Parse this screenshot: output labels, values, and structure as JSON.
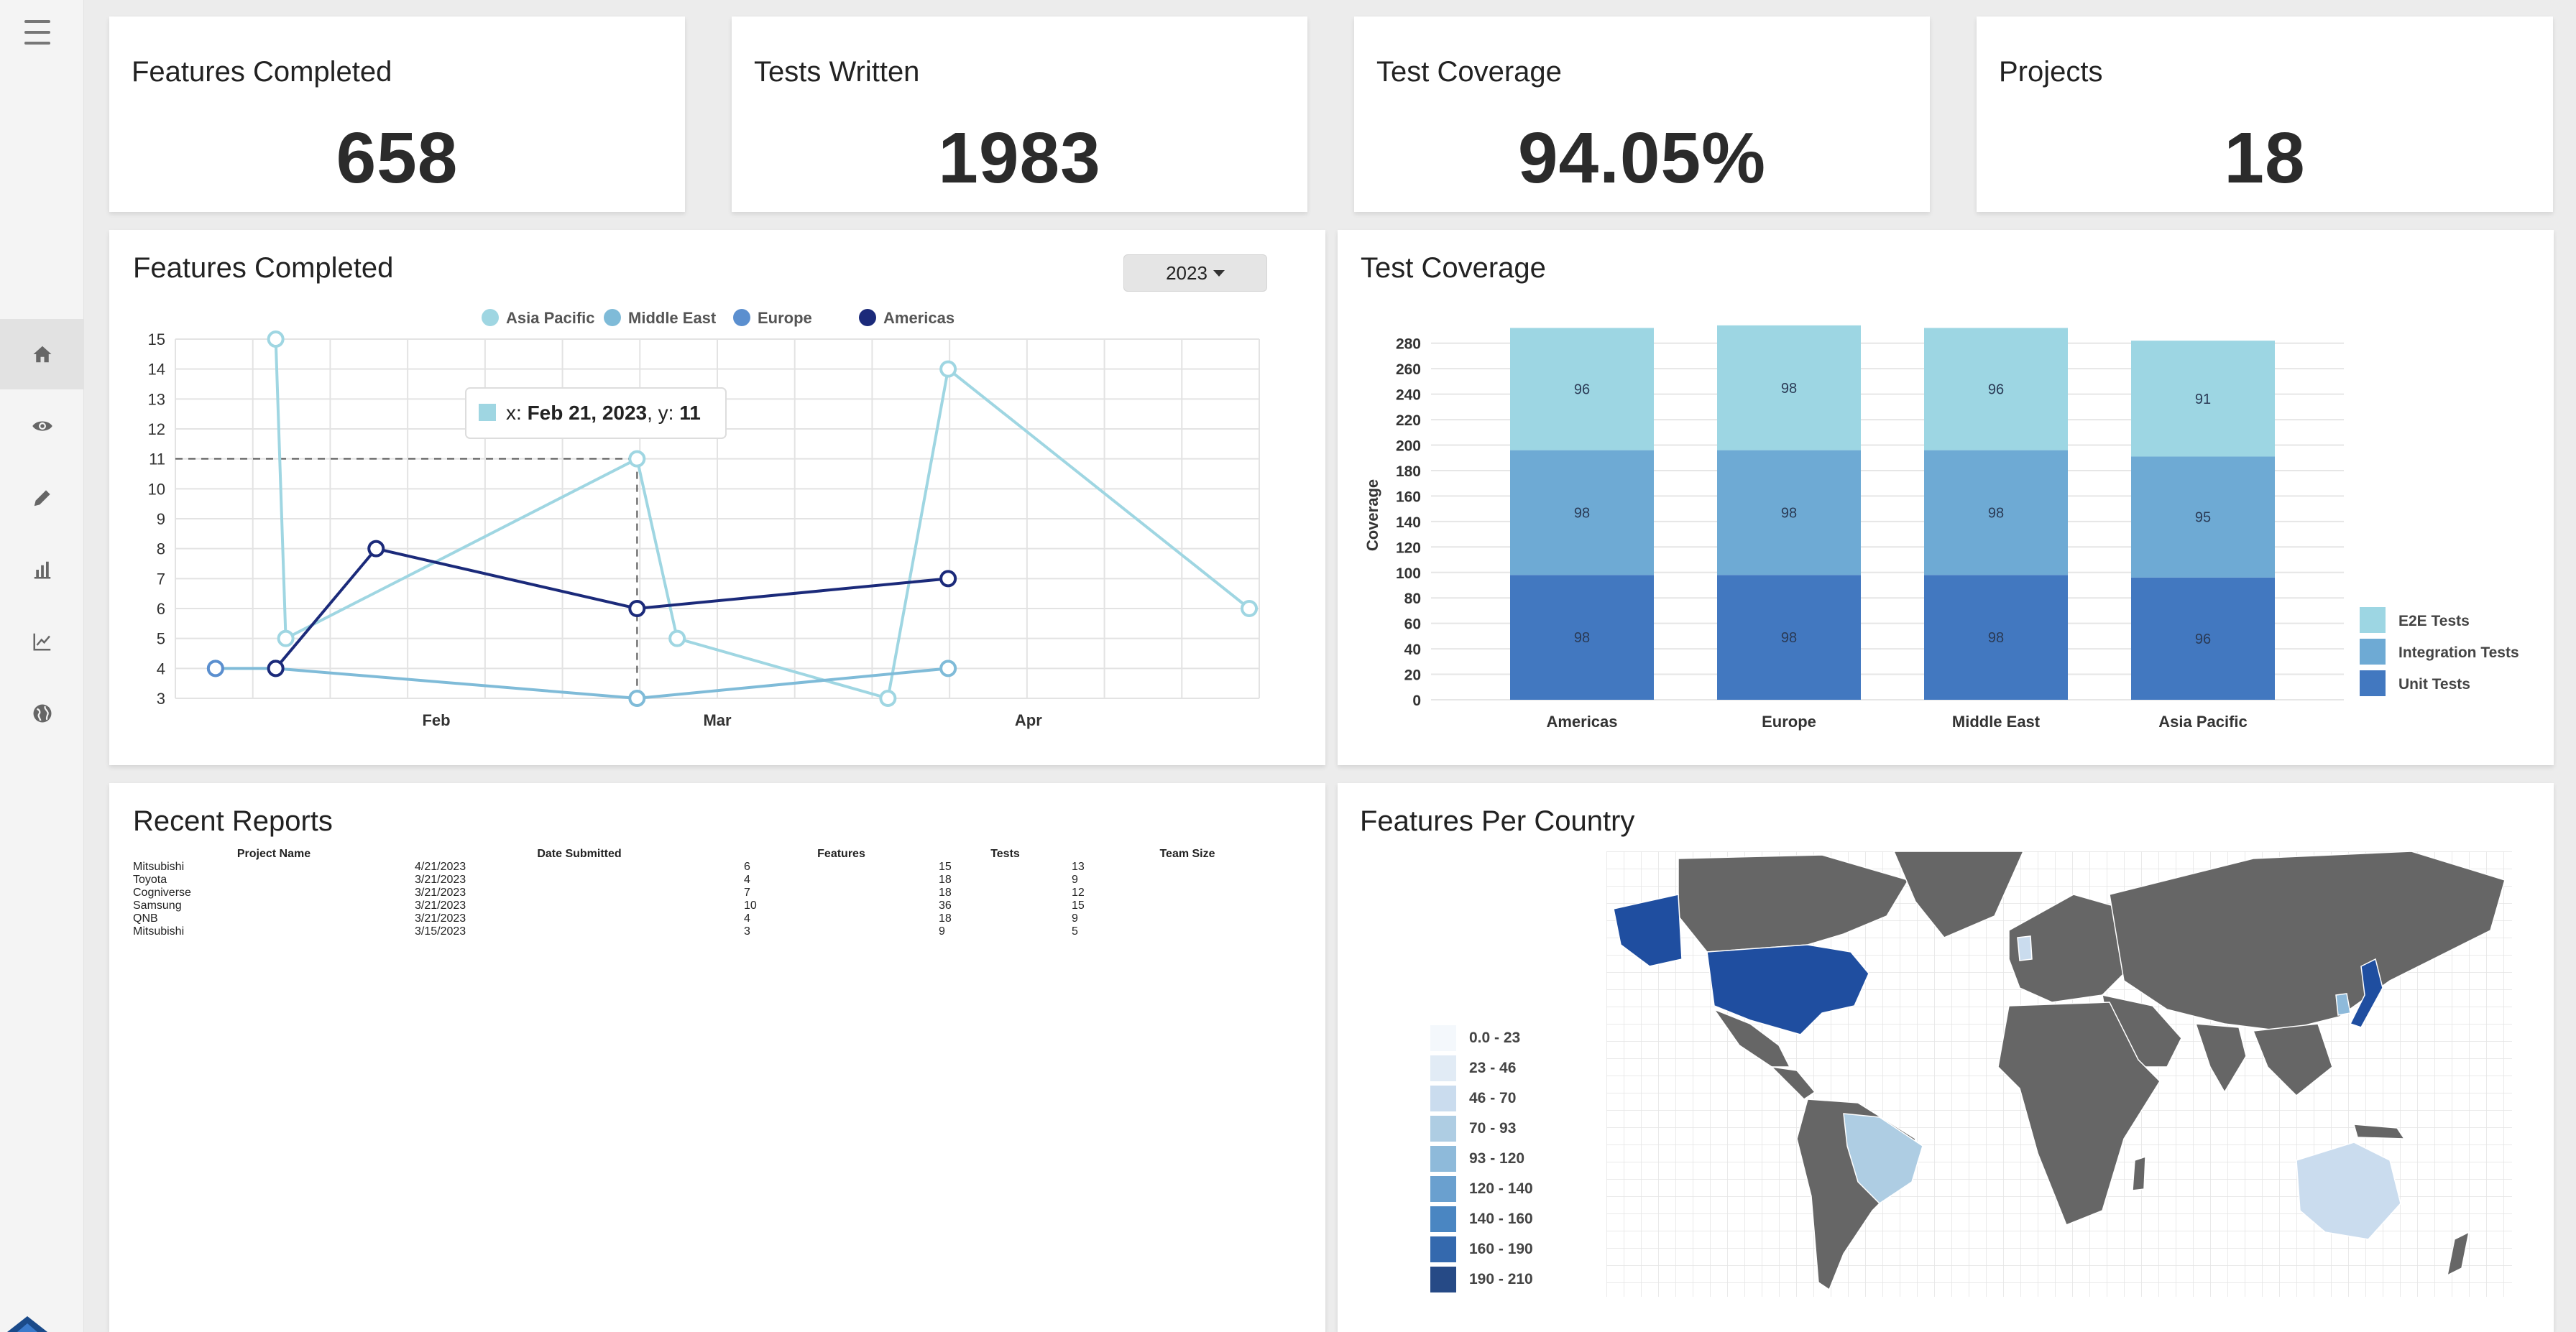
{
  "sidebar": {
    "menu_icon": "hamburger-icon",
    "items": [
      {
        "icon": "home-icon",
        "active": true
      },
      {
        "icon": "eye-icon",
        "active": false
      },
      {
        "icon": "pencil-icon",
        "active": false
      },
      {
        "icon": "bar-chart-icon",
        "active": false
      },
      {
        "icon": "line-chart-icon",
        "active": false
      },
      {
        "icon": "globe-icon",
        "active": false
      }
    ]
  },
  "stats": [
    {
      "title": "Features Completed",
      "value": "658"
    },
    {
      "title": "Tests Written",
      "value": "1983"
    },
    {
      "title": "Test Coverage",
      "value": "94.05%"
    },
    {
      "title": "Projects",
      "value": "18"
    }
  ],
  "features_panel": {
    "title": "Features Completed",
    "year_selector": "2023",
    "tooltip": {
      "x_label": "x: ",
      "x_value": "Feb 21, 2023",
      "y_label": ", y: ",
      "y_value": "11"
    }
  },
  "coverage_panel": {
    "title": "Test Coverage"
  },
  "reports": {
    "title": "Recent Reports",
    "columns": [
      "Project Name",
      "Date Submitted",
      "Features",
      "Tests",
      "Team Size"
    ],
    "rows": [
      [
        "Mitsubishi",
        "4/21/2023",
        "6",
        "15",
        "13"
      ],
      [
        "Toyota",
        "3/21/2023",
        "4",
        "18",
        "9"
      ],
      [
        "Cogniverse",
        "3/21/2023",
        "7",
        "18",
        "12"
      ],
      [
        "Samsung",
        "3/21/2023",
        "10",
        "36",
        "15"
      ],
      [
        "QNB",
        "3/21/2023",
        "4",
        "18",
        "9"
      ],
      [
        "Mitsubishi",
        "3/15/2023",
        "3",
        "9",
        "5"
      ]
    ]
  },
  "map_panel": {
    "title": "Features Per Country",
    "legend": [
      {
        "label": "0.0 - 23",
        "color": "#f4f8fc"
      },
      {
        "label": "23 - 46",
        "color": "#e1ebf5"
      },
      {
        "label": "46 - 70",
        "color": "#cadcee"
      },
      {
        "label": "70 - 93",
        "color": "#aecde3"
      },
      {
        "label": "93 - 120",
        "color": "#8ebada"
      },
      {
        "label": "120 - 140",
        "color": "#6aa0cf"
      },
      {
        "label": "140 - 160",
        "color": "#4a86c2"
      },
      {
        "label": "160 - 190",
        "color": "#3469ae"
      },
      {
        "label": "190 - 210",
        "color": "#264a86"
      }
    ]
  },
  "chart_data": [
    {
      "type": "line",
      "title": "Features Completed",
      "x_ticks": [
        "Feb",
        "Mar",
        "Apr"
      ],
      "ylim": [
        3,
        15
      ],
      "legend_position": "top",
      "series": [
        {
          "name": "Asia Pacific",
          "color": "#9fd6e2",
          "points": [
            [
              "2023-01-16",
              15
            ],
            [
              "2023-01-17",
              5
            ],
            [
              "2023-02-21",
              11
            ],
            [
              "2023-02-25",
              5
            ],
            [
              "2023-03-18",
              3
            ],
            [
              "2023-03-24",
              14
            ],
            [
              "2023-04-23",
              6
            ]
          ]
        },
        {
          "name": "Middle East",
          "color": "#7fbbd8",
          "points": [
            [
              "2023-01-10",
              4
            ],
            [
              "2023-01-16",
              4
            ],
            [
              "2023-02-21",
              3
            ],
            [
              "2023-03-24",
              4
            ]
          ]
        },
        {
          "name": "Europe",
          "color": "#5b8fcf",
          "points": [
            [
              "2023-01-10",
              4
            ]
          ]
        },
        {
          "name": "Americas",
          "color": "#1b2a7a",
          "points": [
            [
              "2023-01-16",
              4
            ],
            [
              "2023-01-26",
              8
            ],
            [
              "2023-02-21",
              6
            ],
            [
              "2023-03-24",
              7
            ]
          ]
        }
      ]
    },
    {
      "type": "bar",
      "stacked": true,
      "title": "Test Coverage",
      "ylabel": "Coverage",
      "ylim": [
        0,
        290
      ],
      "y_ticks": [
        0,
        20,
        40,
        60,
        80,
        100,
        120,
        140,
        160,
        180,
        200,
        220,
        240,
        260,
        280
      ],
      "categories": [
        "Americas",
        "Europe",
        "Middle East",
        "Asia Pacific"
      ],
      "legend_position": "right",
      "series": [
        {
          "name": "Unit Tests",
          "color": "#4278c0",
          "values": [
            98,
            98,
            98,
            96
          ]
        },
        {
          "name": "Integration Tests",
          "color": "#6eaad4",
          "values": [
            98,
            98,
            98,
            95
          ]
        },
        {
          "name": "E2E Tests",
          "color": "#9dd6e3",
          "values": [
            96,
            98,
            96,
            91
          ]
        }
      ],
      "legend_order": [
        "E2E Tests",
        "Integration Tests",
        "Unit Tests"
      ]
    }
  ]
}
